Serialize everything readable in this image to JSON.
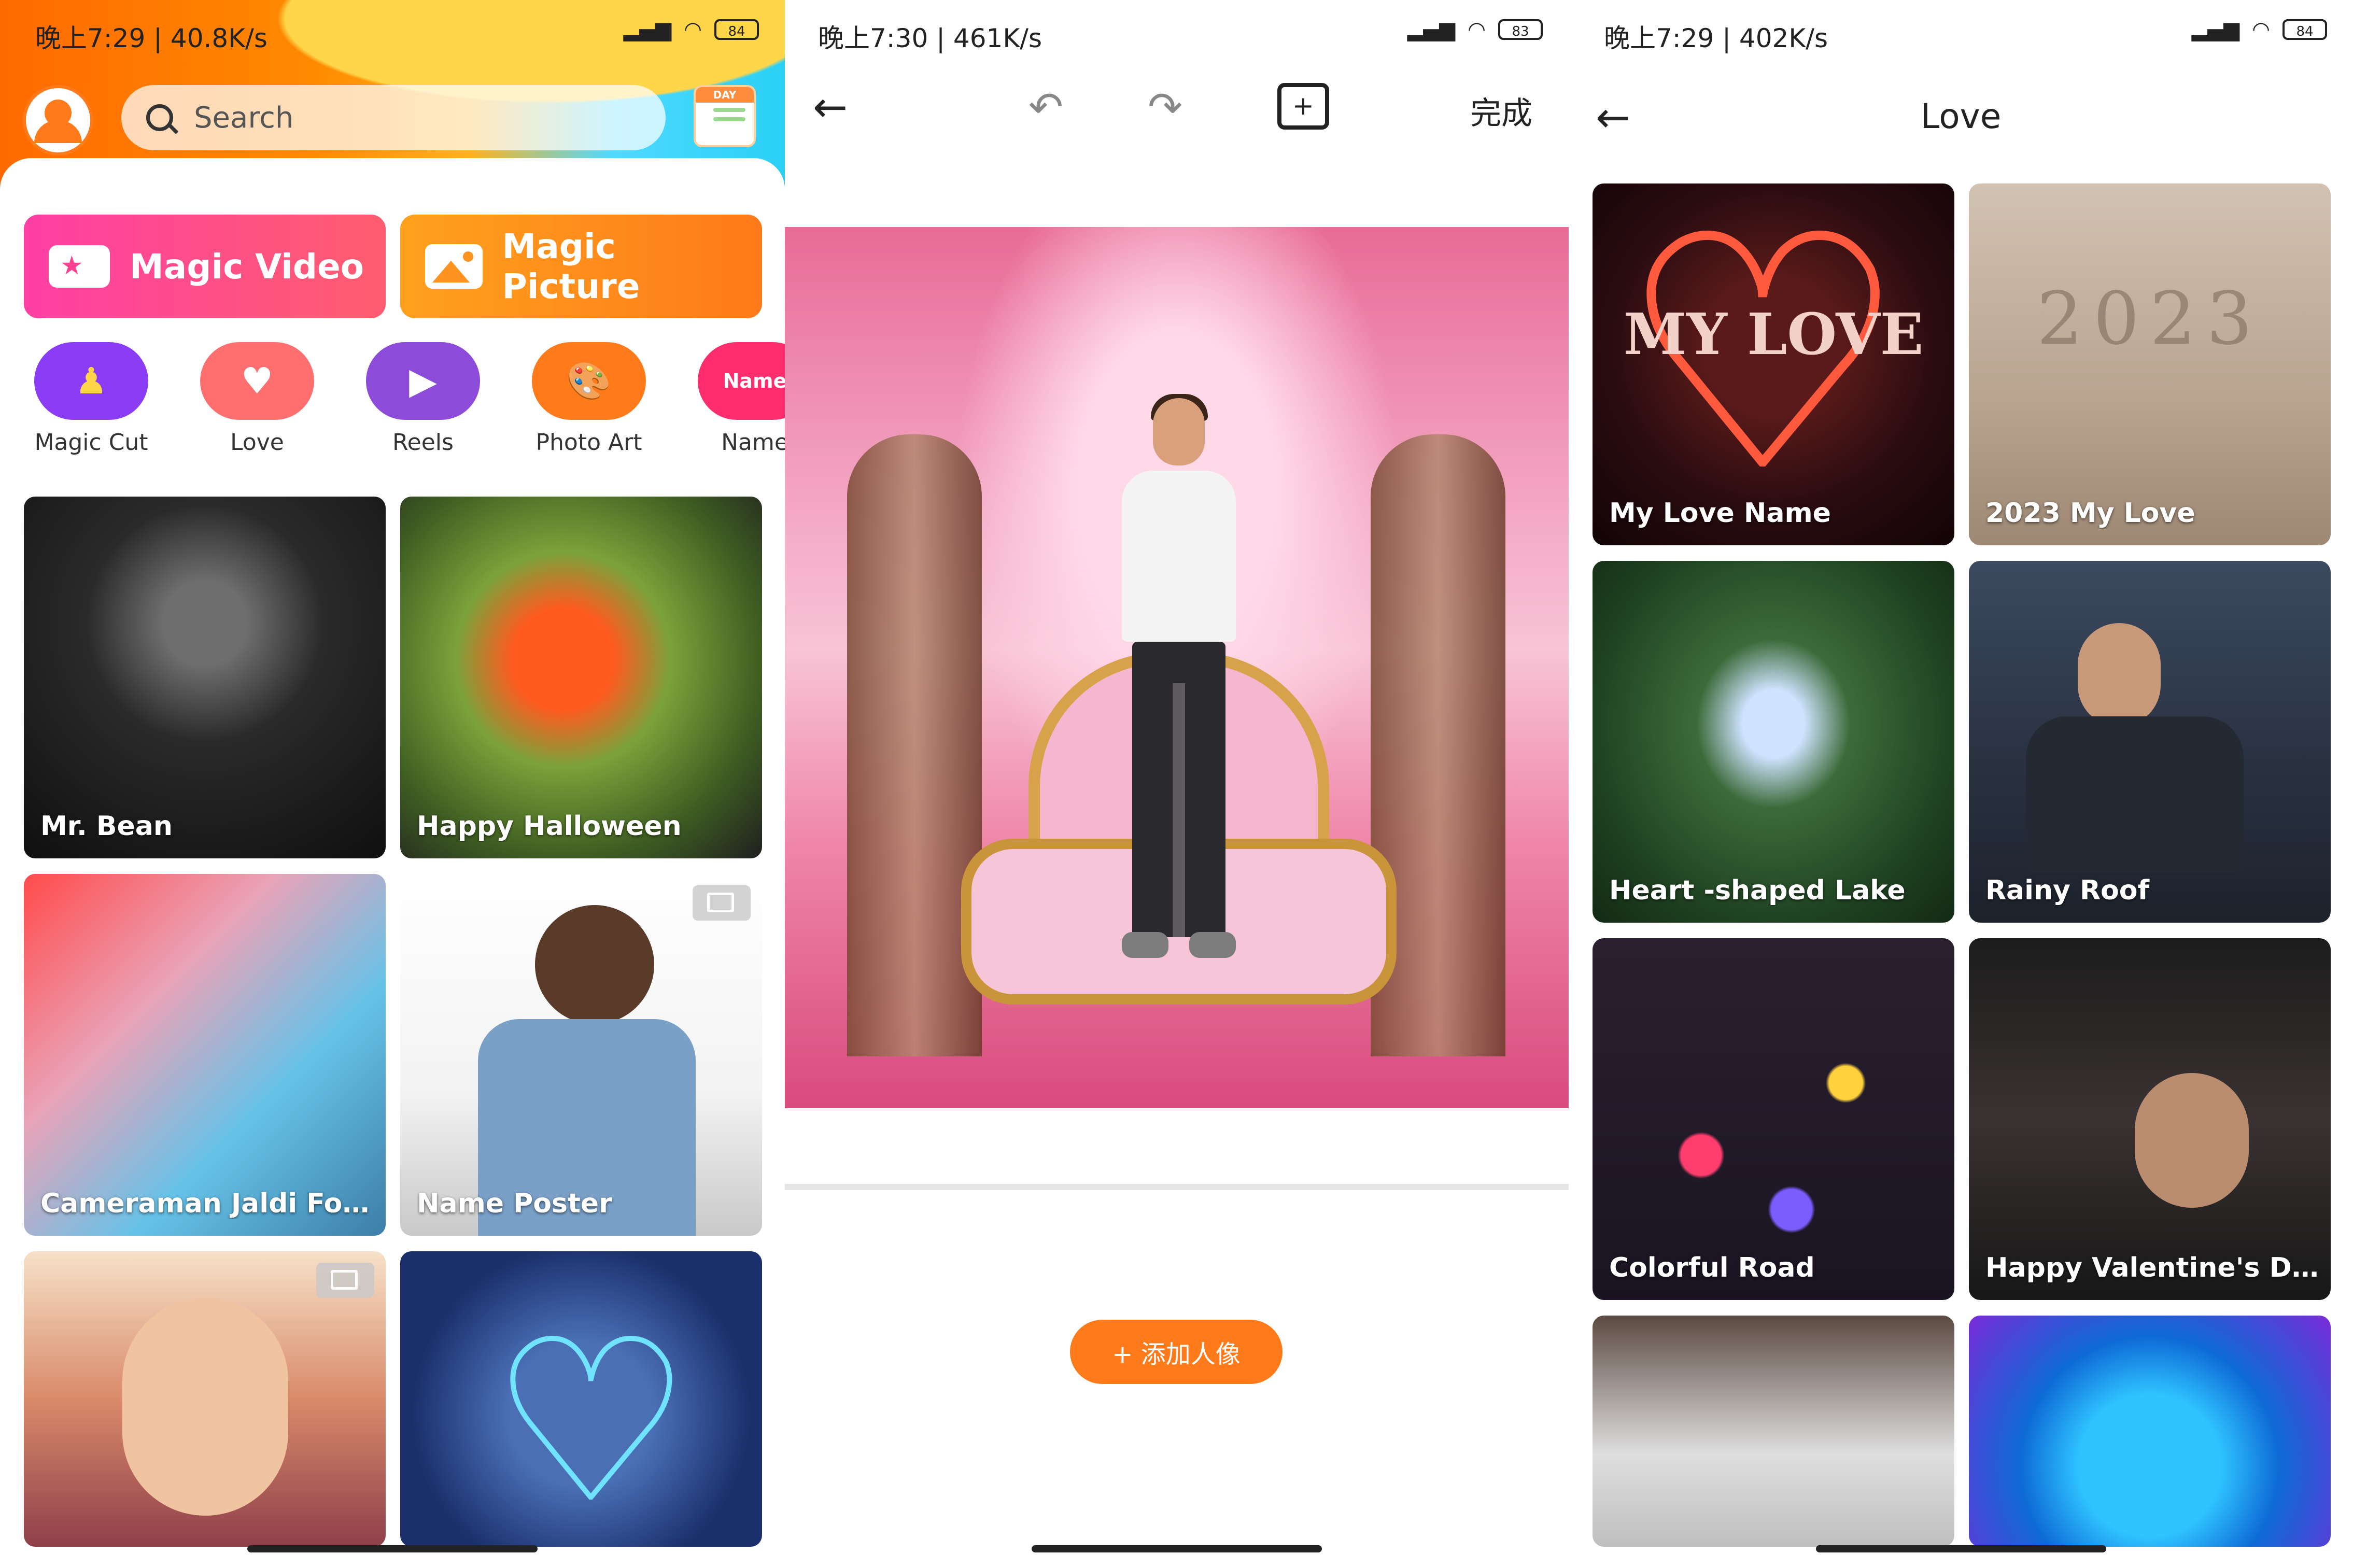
{
  "panel1": {
    "status": {
      "time": "晚上7:29 | 40.8K/s",
      "battery": "84"
    },
    "search": {
      "placeholder": "Search"
    },
    "calendar_label": "DAY",
    "magic_video": "Magic Video",
    "magic_picture": "Magic Picture",
    "categories": [
      {
        "label": "Magic Cut",
        "color": "#8b3cf5"
      },
      {
        "label": "Love",
        "color": "#ff6f6f"
      },
      {
        "label": "Reels",
        "color": "#8c4bd8"
      },
      {
        "label": "Photo Art",
        "color": "#ff7a1a"
      },
      {
        "label": "Name",
        "badge": "Name",
        "color": "#ff2d6e"
      }
    ],
    "tiles": [
      {
        "caption": "Mr. Bean"
      },
      {
        "caption": "Happy Halloween"
      },
      {
        "caption": "Cameraman Jaldi Foc..."
      },
      {
        "caption": "Name Poster"
      },
      {
        "caption": ""
      },
      {
        "caption": ""
      }
    ]
  },
  "panel2": {
    "status": {
      "time": "晚上7:30 | 461K/s",
      "battery": "83"
    },
    "done_label": "完成",
    "add_button": "+ 添加人像"
  },
  "panel3": {
    "status": {
      "time": "晚上7:29 | 402K/s",
      "battery": "84"
    },
    "title": "Love",
    "tiles": [
      {
        "caption": "My Love Name",
        "overlay": "MY LOVE"
      },
      {
        "caption": "2023 My Love",
        "overlay": "2023"
      },
      {
        "caption": "Heart -shaped Lake"
      },
      {
        "caption": "Rainy Roof"
      },
      {
        "caption": "Colorful Road"
      },
      {
        "caption": "Happy Valentine's Day"
      },
      {
        "caption": ""
      },
      {
        "caption": ""
      }
    ]
  }
}
